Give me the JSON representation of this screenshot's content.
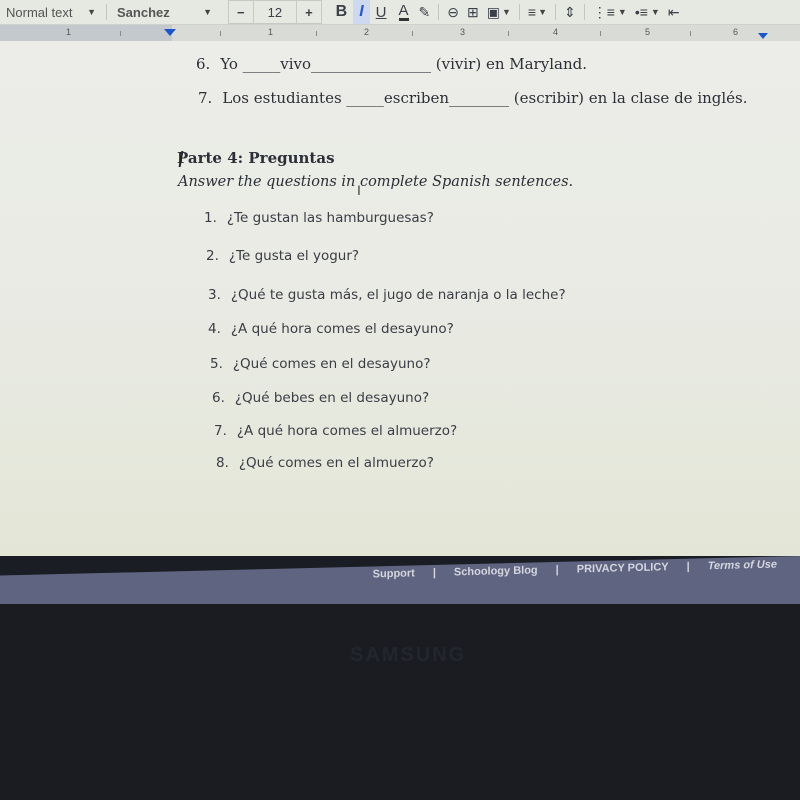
{
  "toolbar": {
    "style_select": "Normal text",
    "font_select": "Sanchez",
    "font_size_decrease": "−",
    "font_size": "12",
    "font_size_increase": "+",
    "bold": "B",
    "italic": "I",
    "underline": "U",
    "text_color": "A",
    "icons": {
      "highlight": "✎",
      "link": "⊖",
      "comment": "⊞",
      "image": "▣",
      "align": "≡",
      "line_spacing": "⇕",
      "numbered_list": "⋮≡",
      "bulleted_list": "•≡",
      "indent": "⇤"
    }
  },
  "ruler": {
    "numbers": [
      "1",
      "1",
      "2",
      "3",
      "4",
      "5",
      "6"
    ]
  },
  "document": {
    "exercise_items": [
      {
        "num": "6.",
        "before": "Yo ",
        "blank_pre": "_____",
        "answer": "vivo",
        "blank_post": "________________",
        "after": " (vivir) en Maryland."
      },
      {
        "num": "7.",
        "before": "Los estudiantes ",
        "blank_pre": "_____",
        "answer": "escriben",
        "blank_post": "________",
        "after": " (escribir) en la clase de inglés."
      }
    ],
    "section_heading": "Parte 4: Preguntas",
    "instructions": "Answer the questions in complete Spanish sentences.",
    "questions": [
      {
        "num": "1.",
        "text": "¿Te gustan las hamburguesas?"
      },
      {
        "num": "2.",
        "text": "¿Te gusta el yogur?"
      },
      {
        "num": "3.",
        "text": "¿Qué te gusta más, el jugo de naranja o la leche?"
      },
      {
        "num": "4.",
        "text": "¿A qué hora comes el desayuno?"
      },
      {
        "num": "5.",
        "text": "¿Qué comes en el desayuno?"
      },
      {
        "num": "6.",
        "text": "¿Qué bebes en el desayuno?"
      },
      {
        "num": "7.",
        "text": "¿A qué hora comes el almuerzo?"
      },
      {
        "num": "8.",
        "text": "¿Qué comes en el almuerzo?"
      }
    ]
  },
  "footer": {
    "links": [
      "Support",
      "Schoology Blog",
      "PRIVACY POLICY",
      "Terms of Use"
    ],
    "separator": "|"
  },
  "monitor": {
    "brand": "SAMSUNG"
  }
}
